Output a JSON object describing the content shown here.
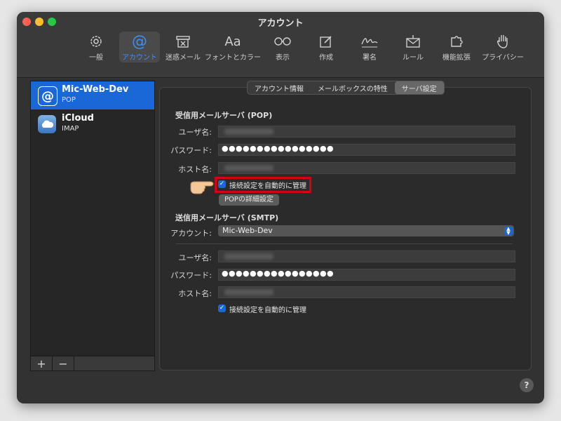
{
  "window": {
    "title": "アカウント"
  },
  "toolbar": [
    {
      "label": "一般",
      "icon": "gear-icon"
    },
    {
      "label": "アカウント",
      "icon": "at-icon",
      "active": true
    },
    {
      "label": "迷惑メール",
      "icon": "junk-mail-icon"
    },
    {
      "label": "フォントとカラー",
      "icon": "fonts-icon"
    },
    {
      "label": "表示",
      "icon": "glasses-icon"
    },
    {
      "label": "作成",
      "icon": "compose-icon"
    },
    {
      "label": "署名",
      "icon": "signature-icon"
    },
    {
      "label": "ルール",
      "icon": "rules-icon"
    },
    {
      "label": "機能拡張",
      "icon": "puzzle-icon"
    },
    {
      "label": "プライバシー",
      "icon": "hand-icon"
    }
  ],
  "accounts": [
    {
      "name": "Mic-Web-Dev",
      "type": "POP",
      "icon": "at-icon",
      "selected": true
    },
    {
      "name": "iCloud",
      "type": "IMAP",
      "icon": "cloud-icon"
    }
  ],
  "sidebar_buttons": {
    "add": "+",
    "remove": "−"
  },
  "tabs": [
    "アカウント情報",
    "メールボックスの特性",
    "サーバ設定"
  ],
  "incoming": {
    "title": "受信用メールサーバ (POP)",
    "username_label": "ユーザ名:",
    "password_label": "パスワード:",
    "password_value": "●●●●●●●●●●●●●●●●",
    "host_label": "ホスト名:",
    "auto_manage_label": "接続設定を自動的に管理",
    "advanced_button": "POPの詳細設定"
  },
  "outgoing": {
    "title": "送信用メールサーバ (SMTP)",
    "account_label": "アカウント:",
    "account_value": "Mic-Web-Dev",
    "username_label": "ユーザ名:",
    "password_label": "パスワード:",
    "password_value": "●●●●●●●●●●●●●●●●",
    "host_label": "ホスト名:",
    "auto_manage_label": "接続設定を自動的に管理"
  },
  "help": "?",
  "colors": {
    "accent": "#1a67d8",
    "highlight_box": "#d7000f"
  }
}
